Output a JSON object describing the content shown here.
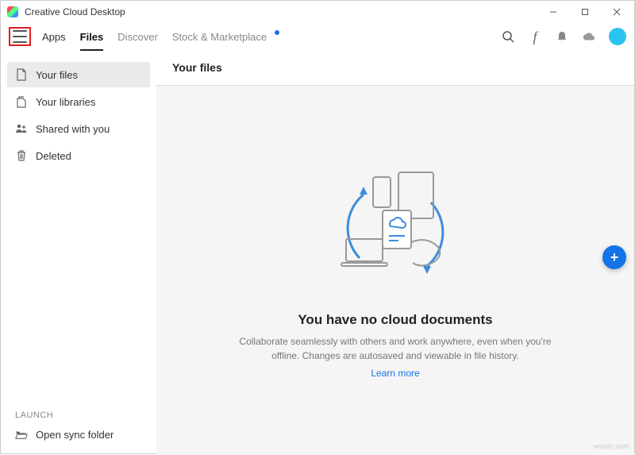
{
  "window": {
    "title": "Creative Cloud Desktop"
  },
  "tabs": {
    "apps": "Apps",
    "files": "Files",
    "discover": "Discover",
    "stock": "Stock & Marketplace"
  },
  "sidebar": {
    "items": [
      {
        "label": "Your files"
      },
      {
        "label": "Your libraries"
      },
      {
        "label": "Shared with you"
      },
      {
        "label": "Deleted"
      }
    ],
    "launch_label": "LAUNCH",
    "open_sync": "Open sync folder"
  },
  "main": {
    "header": "Your files",
    "empty_title": "You have no cloud documents",
    "empty_sub": "Collaborate seamlessly with others and work anywhere, even when you're offline. Changes are autosaved and viewable in file history.",
    "learn_more": "Learn more"
  },
  "watermark": "wsxdn.com"
}
